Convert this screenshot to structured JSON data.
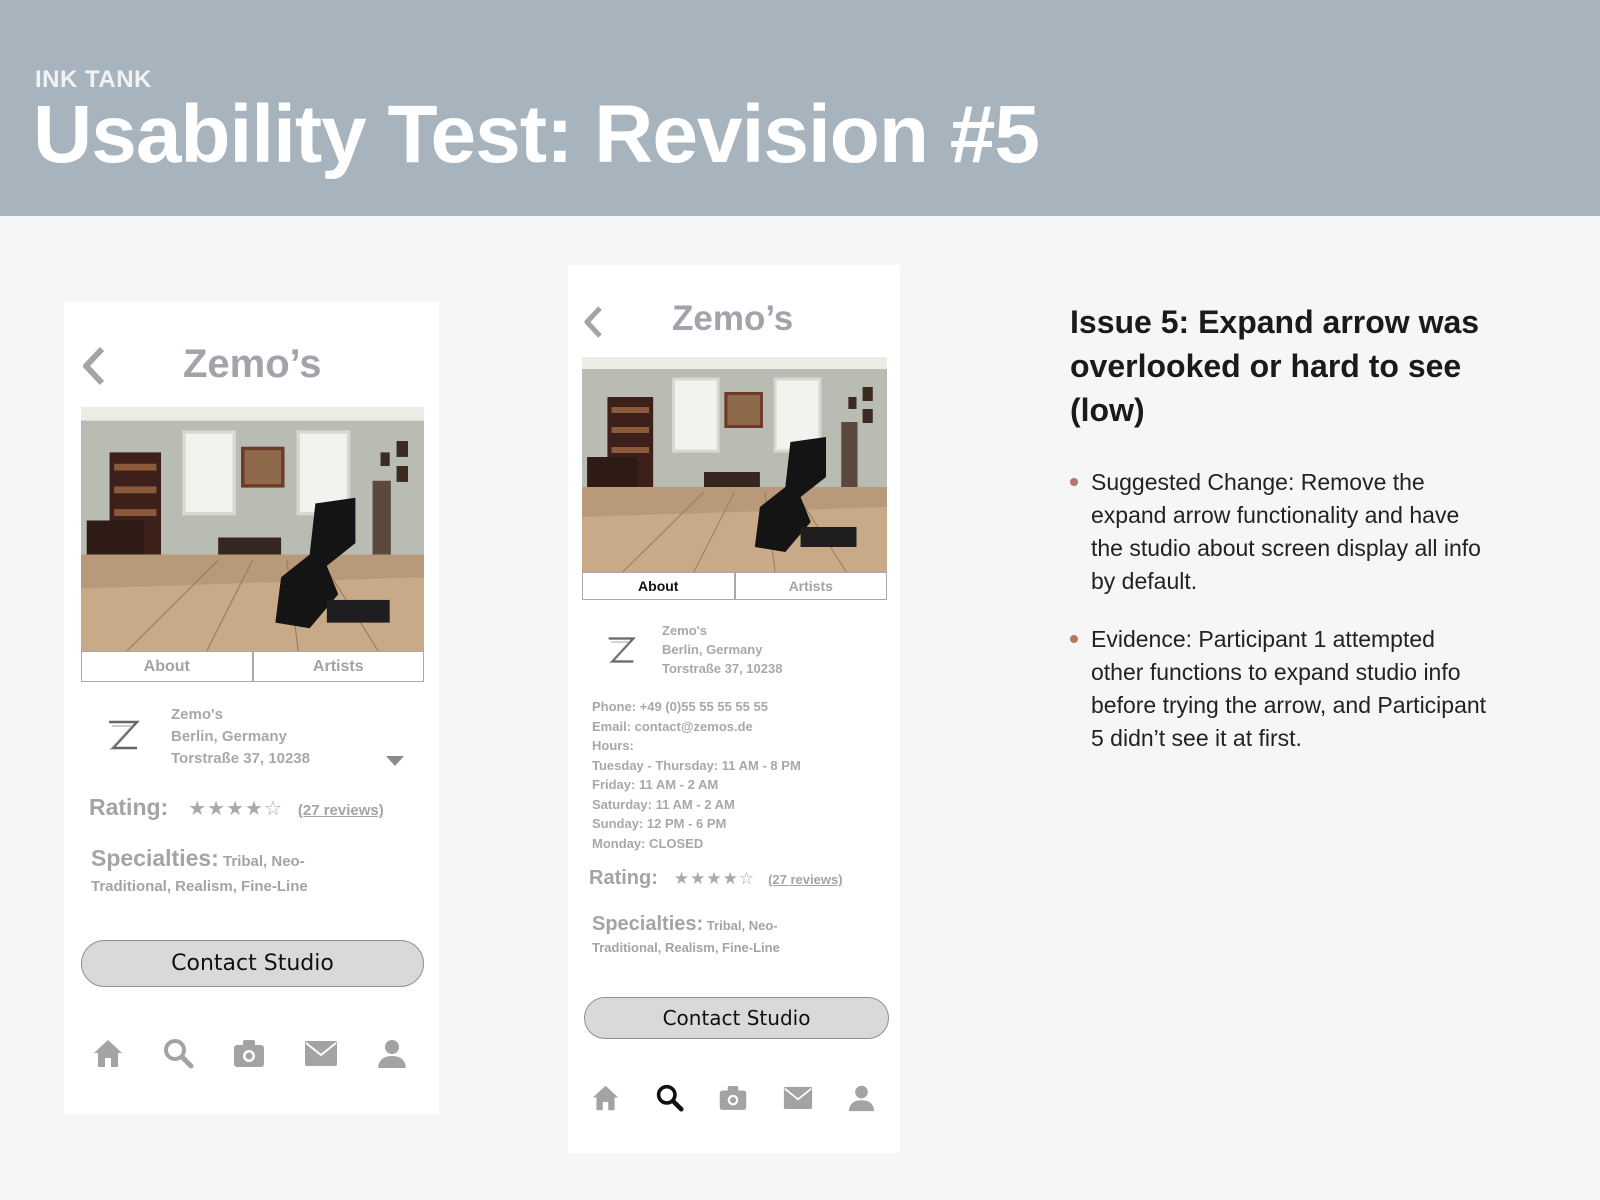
{
  "header": {
    "eyebrow": "INK TANK",
    "title": "Usability Test: Revision #5"
  },
  "phone_before": {
    "studio_name": "Zemo’s",
    "tabs": [
      {
        "label": "About",
        "active": false
      },
      {
        "label": "Artists",
        "active": false
      }
    ],
    "info_lines": [
      "Zemo's",
      "Berlin, Germany",
      "Torstraße 37, 10238"
    ],
    "rating_label": "Rating:",
    "stars": "★★★★☆",
    "reviews": "(27 reviews)",
    "specialties_label": "Specialties:",
    "specialties_text": "Tribal, Neo-Traditional, Realism, Fine-Line",
    "contact_label": "Contact Studio",
    "nav_active": "none"
  },
  "phone_after": {
    "studio_name": "Zemo’s",
    "tabs": [
      {
        "label": "About",
        "active": true
      },
      {
        "label": "Artists",
        "active": false
      }
    ],
    "info_lines": [
      "Zemo's",
      "Berlin, Germany",
      "Torstraße 37, 10238"
    ],
    "details": [
      "Phone: +49 (0)55 55 55 55 55",
      "Email: contact@zemos.de",
      "Hours:",
      "Tuesday - Thursday: 11 AM - 8 PM",
      "Friday: 11 AM - 2 AM",
      "Saturday: 11 AM - 2 AM",
      "Sunday: 12 PM - 6 PM",
      "Monday: CLOSED"
    ],
    "rating_label": "Rating:",
    "stars": "★★★★☆",
    "reviews": "(27 reviews)",
    "specialties_label": "Specialties:",
    "specialties_text": "Tribal, Neo-Traditional, Realism, Fine-Line",
    "contact_label": "Contact Studio",
    "nav_active": "search"
  },
  "issue": {
    "title": "Issue 5: Expand arrow was overlooked or hard to see (low)",
    "bullets": [
      "Suggested Change: Remove the expand arrow functionality and have the studio about screen display all info by default.",
      "Evidence: Participant 1 attempted other functions to expand studio info before trying the arrow, and Participant 5 didn’t see it at first."
    ]
  },
  "colors": {
    "header_bg": "#a7b4bd",
    "bullet": "#b87563",
    "nav_active": "#111111",
    "nav_inactive": "#a3a3a3"
  }
}
